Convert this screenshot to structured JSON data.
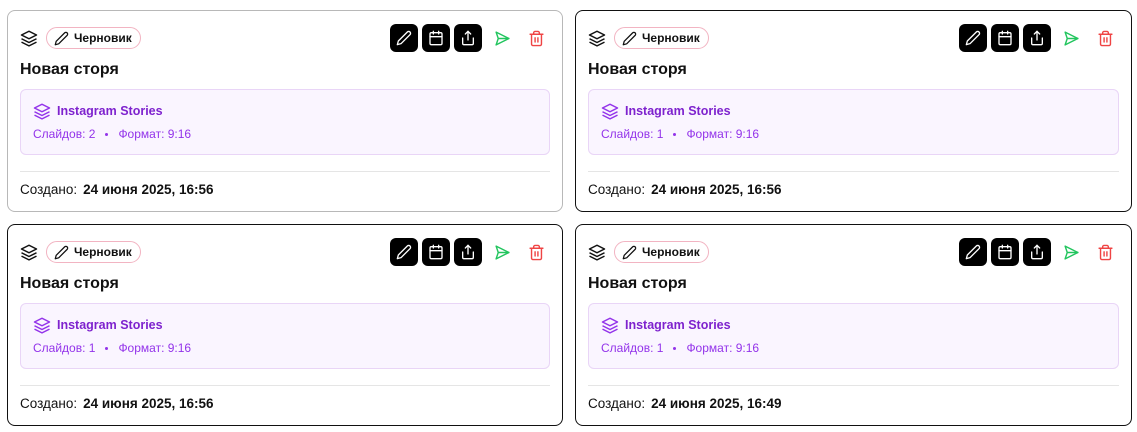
{
  "cards": [
    {
      "status_badge": "Черновик",
      "title": "Новая сторя",
      "info_title": "Instagram Stories",
      "slides_text": "Слайдов: 2",
      "format_text": "Формат: 9:16",
      "created_label": "Создано:",
      "created_value": "24 июня 2025, 16:56"
    },
    {
      "status_badge": "Черновик",
      "title": "Новая сторя",
      "info_title": "Instagram Stories",
      "slides_text": "Слайдов: 1",
      "format_text": "Формат: 9:16",
      "created_label": "Создано:",
      "created_value": "24 июня 2025, 16:56"
    },
    {
      "status_badge": "Черновик",
      "title": "Новая сторя",
      "info_title": "Instagram Stories",
      "slides_text": "Слайдов: 1",
      "format_text": "Формат: 9:16",
      "created_label": "Создано:",
      "created_value": "24 июня 2025, 16:56"
    },
    {
      "status_badge": "Черновик",
      "title": "Новая сторя",
      "info_title": "Instagram Stories",
      "slides_text": "Слайдов: 1",
      "format_text": "Формат: 9:16",
      "created_label": "Создано:",
      "created_value": "24 июня 2025, 16:49"
    }
  ],
  "icons": {
    "type": "layers-icon",
    "badge": "pencil-icon",
    "actions": [
      "edit-icon",
      "calendar-icon",
      "export-icon",
      "send-icon",
      "trash-icon"
    ],
    "info": "layers-icon"
  },
  "colors": {
    "action_bg": "#000000",
    "send": "#22c55e",
    "trash": "#ef4444",
    "info_bg": "#faf5ff",
    "info_border": "#e9d5f7",
    "info_text": "#7e22ce",
    "badge_border": "#f2b4c2"
  }
}
